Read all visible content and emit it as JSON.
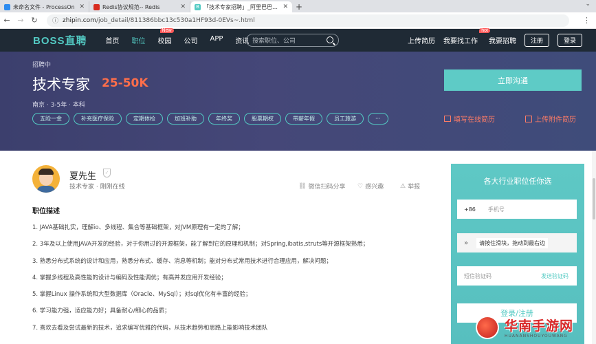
{
  "browser": {
    "tabs": [
      {
        "title": "未命名文件 - ProcessOn",
        "fav_color": "#2d8cf0"
      },
      {
        "title": "Redis协议规范-- Redis",
        "fav_color": "#d82c20"
      },
      {
        "title": "「技术专家招聘」_阿里巴巴集团",
        "fav_color": "#53cac3",
        "fav_letter": "B"
      }
    ],
    "new_tab": "+",
    "url_host": "zhipin.com",
    "url_path": "/job_detail/811386bbc13c530a1HF93d-0EVs~.html"
  },
  "nav": {
    "logo": "BOSS直聘",
    "menu": [
      "首页",
      "职位",
      "校园",
      "公司",
      "APP",
      "资讯"
    ],
    "new_badge": "New",
    "search_placeholder": "搜索职位、公司",
    "upload_resume": "上传简历",
    "find_job": "我要找工作",
    "hot_badge": "hot",
    "recruit": "我要招聘",
    "register": "注册",
    "login": "登录"
  },
  "job": {
    "status": "招聘中",
    "title": "技术专家",
    "salary": "25-50K",
    "meta": "南京 · 3-5年 · 本科",
    "tags": [
      "五险一金",
      "补充医疗保险",
      "定期体检",
      "加班补助",
      "年终奖",
      "股票期权",
      "带薪年假",
      "员工旅游",
      "···"
    ],
    "chat_button": "立即沟通",
    "fill_resume": "填写在线简历",
    "upload_attachment": "上传附件简历"
  },
  "recruiter": {
    "name": "夏先生",
    "role": "技术专家 · 刚刚在线",
    "share": "微信扫码分享",
    "interest": "感兴趣",
    "report": "举报"
  },
  "description": {
    "heading": "职位描述",
    "lines": [
      "1. JAVA基础扎实，理解io、多线程、集合等基础框架，对JVM原理有一定的了解；",
      "2. 3年及以上使用JAVA开发的经验，对于你用过的开源框架，能了解到它的原理和机制；对Spring,ibatis,struts等开源框架熟悉；",
      "3. 熟悉分布式系统的设计和应用，熟悉分布式、缓存、消息等机制；能对分布式常用技术进行合理应用，解决问题；",
      "4. 掌握多线程及高性能的设计与编码及性能调优；有高并发应用开发经验；",
      "5. 掌握Linux 操作系统和大型数据库（Oracle、MySql）；对sql优化有丰富的经验；",
      "6. 学习能力强，适应能力好；具备耐心/细心的品质；",
      "7. 喜欢去看及尝试最新的技术，追求编写优雅的代码，从技术趋势和思路上能影响技术团队"
    ]
  },
  "sidebar": {
    "title": "各大行业职位任你选",
    "country_code": "+86",
    "phone_placeholder": "手机号",
    "slider_hint": "请按住滑块，拖动到最右边",
    "code_placeholder": "短信验证码",
    "send_code": "发送验证码",
    "register_button": "登录/注册"
  },
  "watermark": {
    "text": "华南手游网",
    "sub": "HUANANSHOUYOUWANG"
  }
}
